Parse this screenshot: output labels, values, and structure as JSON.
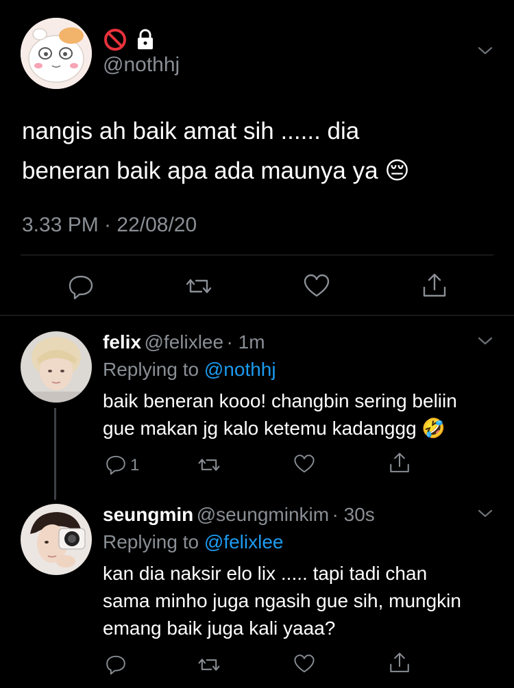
{
  "main_tweet": {
    "handle": "@nothhj",
    "text_line1": "nangis ah baik amat sih ...... dia",
    "text_line2": "beneran baik apa ada maunya ya 😔",
    "timestamp": "3.33 PM · 22/08/20",
    "badges": [
      "no-entry-icon",
      "lock-icon"
    ]
  },
  "replies": [
    {
      "name": "felix",
      "handle": "@felixlee",
      "time": "· 1m",
      "replying_prefix": "Replying to",
      "replying_to": "@nothhj",
      "line1": "baik beneran kooo! changbin sering beliin",
      "line2": "gue makan jg kalo ketemu kadanggg 🤣",
      "reply_count": "1"
    },
    {
      "name": "seungmin",
      "handle": "@seungminkim",
      "time": "· 30s",
      "replying_prefix": "Replying to",
      "replying_to": "@felixlee",
      "line1": "kan dia naksir elo lix ..... tapi tadi chan",
      "line2": "sama minho juga ngasih gue sih, mungkin",
      "line3": "emang baik juga kali yaaa?"
    }
  ],
  "colors": {
    "background": "#000000",
    "text": "#ffffff",
    "muted": "#8a8f95",
    "link": "#1d9bf0"
  }
}
